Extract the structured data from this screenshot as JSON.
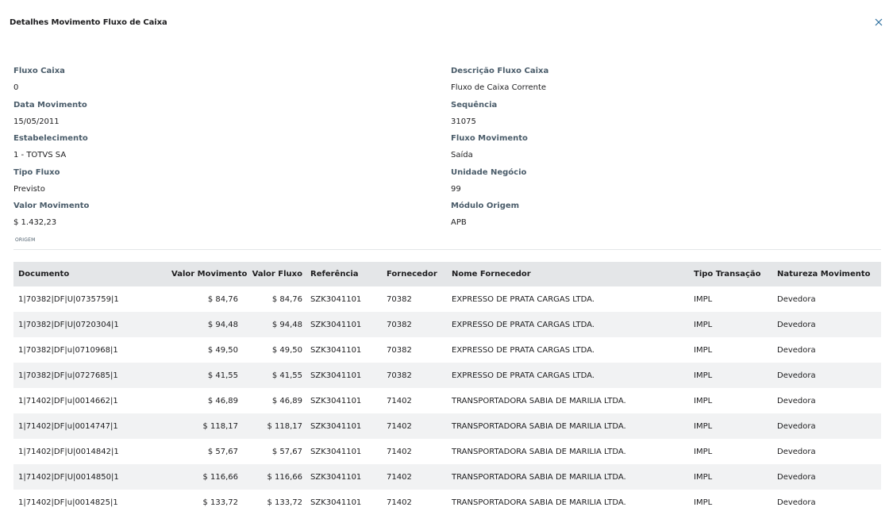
{
  "modal": {
    "title": "Detalhes Movimento Fluxo de Caixa",
    "close_label": "×"
  },
  "fields_left": [
    {
      "label": "Fluxo Caixa",
      "value": "0"
    },
    {
      "label": "Data Movimento",
      "value": "15/05/2011"
    },
    {
      "label": "Estabelecimento",
      "value": "1 - TOTVS SA"
    },
    {
      "label": "Tipo Fluxo",
      "value": "Previsto"
    },
    {
      "label": "Valor Movimento",
      "value": "$ 1.432,23"
    }
  ],
  "fields_right": [
    {
      "label": "Descrição Fluxo Caixa",
      "value": "Fluxo de Caixa Corrente"
    },
    {
      "label": "Sequência",
      "value": "31075"
    },
    {
      "label": "Fluxo Movimento",
      "value": "Saída"
    },
    {
      "label": "Unidade Negócio",
      "value": "99"
    },
    {
      "label": "Módulo Origem",
      "value": "APB"
    }
  ],
  "section_label": "ORIGEM",
  "table": {
    "headers": {
      "documento": "Documento",
      "valor_movimento": "Valor Movimento",
      "valor_fluxo": "Valor Fluxo",
      "referencia": "Referência",
      "fornecedor": "Fornecedor",
      "nome_fornecedor": "Nome Fornecedor",
      "tipo_transacao": "Tipo Transação",
      "natureza_movimento": "Natureza Movimento"
    },
    "rows": [
      {
        "documento": "1|70382|DF|U|0735759|1",
        "valor_movimento": "$ 84,76",
        "valor_fluxo": "$ 84,76",
        "referencia": "SZK3041101",
        "fornecedor": "70382",
        "nome_fornecedor": "EXPRESSO DE PRATA CARGAS LTDA.",
        "tipo_transacao": "IMPL",
        "natureza_movimento": "Devedora"
      },
      {
        "documento": "1|70382|DF|U|0720304|1",
        "valor_movimento": "$ 94,48",
        "valor_fluxo": "$ 94,48",
        "referencia": "SZK3041101",
        "fornecedor": "70382",
        "nome_fornecedor": "EXPRESSO DE PRATA CARGAS LTDA.",
        "tipo_transacao": "IMPL",
        "natureza_movimento": "Devedora"
      },
      {
        "documento": "1|70382|DF|u|0710968|1",
        "valor_movimento": "$ 49,50",
        "valor_fluxo": "$ 49,50",
        "referencia": "SZK3041101",
        "fornecedor": "70382",
        "nome_fornecedor": "EXPRESSO DE PRATA CARGAS LTDA.",
        "tipo_transacao": "IMPL",
        "natureza_movimento": "Devedora"
      },
      {
        "documento": "1|70382|DF|u|0727685|1",
        "valor_movimento": "$ 41,55",
        "valor_fluxo": "$ 41,55",
        "referencia": "SZK3041101",
        "fornecedor": "70382",
        "nome_fornecedor": "EXPRESSO DE PRATA CARGAS LTDA.",
        "tipo_transacao": "IMPL",
        "natureza_movimento": "Devedora"
      },
      {
        "documento": "1|71402|DF|u|0014662|1",
        "valor_movimento": "$ 46,89",
        "valor_fluxo": "$ 46,89",
        "referencia": "SZK3041101",
        "fornecedor": "71402",
        "nome_fornecedor": "TRANSPORTADORA SABIA DE MARILIA LTDA.",
        "tipo_transacao": "IMPL",
        "natureza_movimento": "Devedora"
      },
      {
        "documento": "1|71402|DF|u|0014747|1",
        "valor_movimento": "$ 118,17",
        "valor_fluxo": "$ 118,17",
        "referencia": "SZK3041101",
        "fornecedor": "71402",
        "nome_fornecedor": "TRANSPORTADORA SABIA DE MARILIA LTDA.",
        "tipo_transacao": "IMPL",
        "natureza_movimento": "Devedora"
      },
      {
        "documento": "1|71402|DF|U|0014842|1",
        "valor_movimento": "$ 57,67",
        "valor_fluxo": "$ 57,67",
        "referencia": "SZK3041101",
        "fornecedor": "71402",
        "nome_fornecedor": "TRANSPORTADORA SABIA DE MARILIA LTDA.",
        "tipo_transacao": "IMPL",
        "natureza_movimento": "Devedora"
      },
      {
        "documento": "1|71402|DF|U|0014850|1",
        "valor_movimento": "$ 116,66",
        "valor_fluxo": "$ 116,66",
        "referencia": "SZK3041101",
        "fornecedor": "71402",
        "nome_fornecedor": "TRANSPORTADORA SABIA DE MARILIA LTDA.",
        "tipo_transacao": "IMPL",
        "natureza_movimento": "Devedora"
      },
      {
        "documento": "1|71402|DF|u|0014825|1",
        "valor_movimento": "$ 133,72",
        "valor_fluxo": "$ 133,72",
        "referencia": "SZK3041101",
        "fornecedor": "71402",
        "nome_fornecedor": "TRANSPORTADORA SABIA DE MARILIA LTDA.",
        "tipo_transacao": "IMPL",
        "natureza_movimento": "Devedora"
      }
    ]
  },
  "colors": {
    "label": "#4a5c6a",
    "text": "#1d1d1f",
    "header_bg": "#e4e6e8",
    "stripe_bg": "#f1f2f3",
    "close_icon": "#2f6f9f"
  },
  "icons": {
    "close": "close-icon"
  }
}
